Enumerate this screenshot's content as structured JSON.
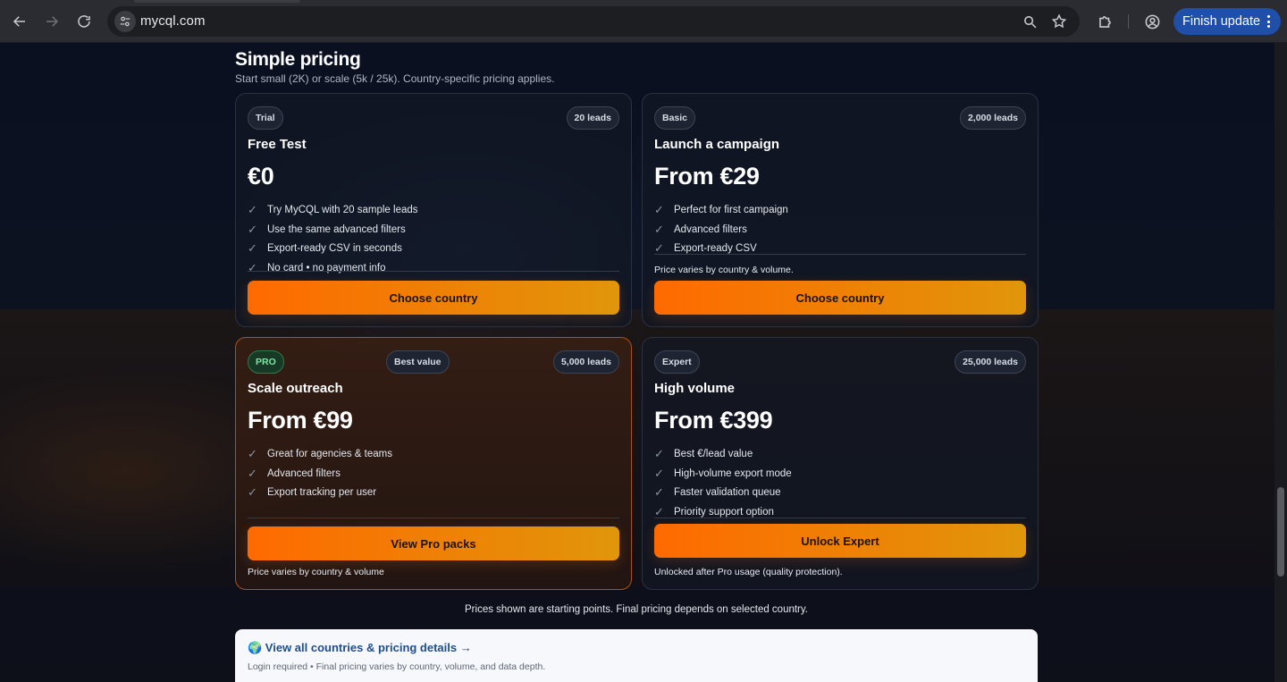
{
  "browser": {
    "url": "mycql.com",
    "finish_update_label": "Finish update"
  },
  "header": {
    "title": "Simple pricing",
    "subtitle": "Start small (2K) or scale (5k / 25k). Country-specific pricing applies."
  },
  "plans": {
    "trial": {
      "tier": "Trial",
      "leads": "20 leads",
      "title": "Free Test",
      "price": "€0",
      "features": [
        "Try MyCQL with 20 sample leads",
        "Use the same advanced filters",
        "Export-ready CSV in seconds",
        "No card • no payment info"
      ],
      "cta": "Choose country"
    },
    "basic": {
      "tier": "Basic",
      "leads": "2,000 leads",
      "title": "Launch a campaign",
      "price": "From €29",
      "features": [
        "Perfect for first campaign",
        "Advanced filters",
        "Export-ready CSV"
      ],
      "note": "Price varies by country & volume.",
      "cta": "Choose country"
    },
    "pro": {
      "tier": "PRO",
      "badge": "Best value",
      "leads": "5,000 leads",
      "title": "Scale outreach",
      "price": "From €99",
      "features": [
        "Great for agencies & teams",
        "Advanced filters",
        "Export tracking per user"
      ],
      "cta": "View Pro packs",
      "note": "Price varies by country & volume"
    },
    "expert": {
      "tier": "Expert",
      "leads": "25,000 leads",
      "title": "High volume",
      "price": "From €399",
      "features": [
        "Best €/lead value",
        "High-volume export mode",
        "Faster validation queue",
        "Priority support option"
      ],
      "cta": "Unlock Expert",
      "note": "Unlocked after Pro usage (quality protection)."
    }
  },
  "footnote": "Prices shown are starting points. Final pricing depends on selected country.",
  "details": {
    "link": "🌍 View all countries & pricing details →",
    "sub": "Login required • Final pricing varies by country, volume, and data depth."
  },
  "check_glyph": "✓",
  "colors": {
    "cta_start": "#ff6a00",
    "cta_end": "#e0960a",
    "pro_badge": "#7ee6a3",
    "update_button": "#1f4fa8"
  }
}
